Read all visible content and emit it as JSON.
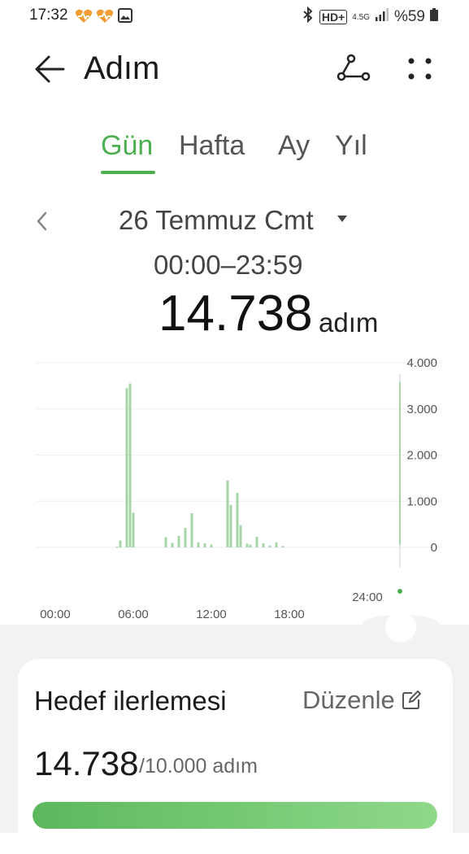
{
  "status_bar": {
    "time": "17:32",
    "network": "4.5G",
    "battery": "%59",
    "hd_label": "HD+"
  },
  "header": {
    "title": "Adım"
  },
  "tabs": [
    {
      "label": "Gün",
      "active": true
    },
    {
      "label": "Hafta",
      "active": false
    },
    {
      "label": "Ay",
      "active": false
    },
    {
      "label": "Yıl",
      "active": false
    }
  ],
  "date": {
    "label": "26 Temmuz Cmt",
    "time_range": "00:00–23:59"
  },
  "summary": {
    "total": "14.738",
    "unit": "adım"
  },
  "chart_data": {
    "type": "bar",
    "x_range_hours": [
      0,
      24
    ],
    "xlabels": [
      "00:00",
      "06:00",
      "12:00",
      "18:00",
      "24:00"
    ],
    "ylabels": [
      "4.000",
      "3.000",
      "2.000",
      "1.000",
      "0"
    ],
    "ylim": [
      0,
      4000
    ],
    "grid": true,
    "bar_color": "#a5d6a7",
    "x": [
      4.75,
      5.0,
      5.5,
      5.75,
      6.0,
      8.5,
      9.0,
      9.5,
      10.0,
      10.5,
      11.0,
      11.5,
      12.0,
      13.25,
      13.5,
      14.0,
      14.25,
      14.75,
      15.0,
      15.5,
      16.0,
      16.5,
      17.0,
      17.5
    ],
    "values": [
      20,
      150,
      3450,
      3550,
      750,
      220,
      100,
      250,
      420,
      740,
      110,
      90,
      60,
      1450,
      920,
      1180,
      480,
      80,
      60,
      230,
      90,
      40,
      110,
      30
    ]
  },
  "goal": {
    "title": "Hedef ilerlemesi",
    "edit_label": "Düzenle",
    "current": "14.738",
    "target_text": "/10.000 adım",
    "progress_fraction": 1.0
  },
  "colors": {
    "accent": "#4caf50",
    "card_bg": "#f2f2f2"
  }
}
